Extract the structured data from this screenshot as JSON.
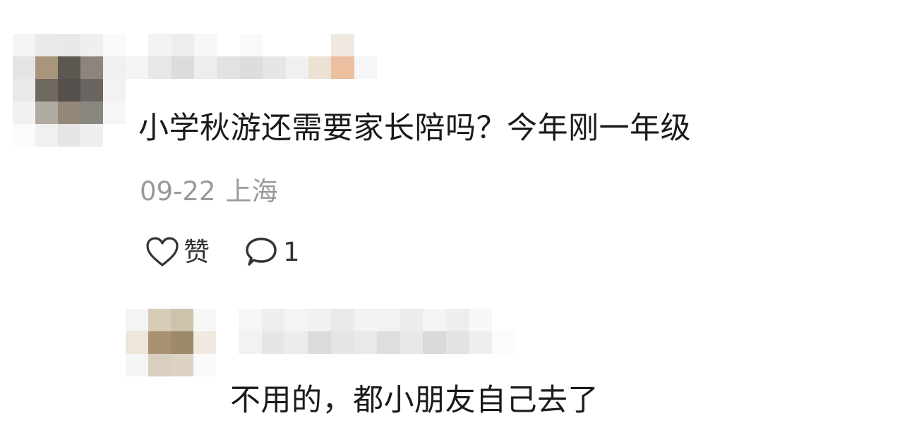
{
  "comment": {
    "text": "小学秋游还需要家长陪吗？今年刚一年级",
    "date": "09-22",
    "location": "上海",
    "like_label": "赞",
    "reply_count": "1"
  },
  "reply": {
    "text": "不用的，都小朋友自己去了"
  },
  "icons": {
    "like": "heart-outline-icon",
    "reply": "comment-bubble-icon"
  },
  "colors": {
    "text": "#1a1a1a",
    "meta": "#9a9a9a",
    "icon": "#333333"
  }
}
